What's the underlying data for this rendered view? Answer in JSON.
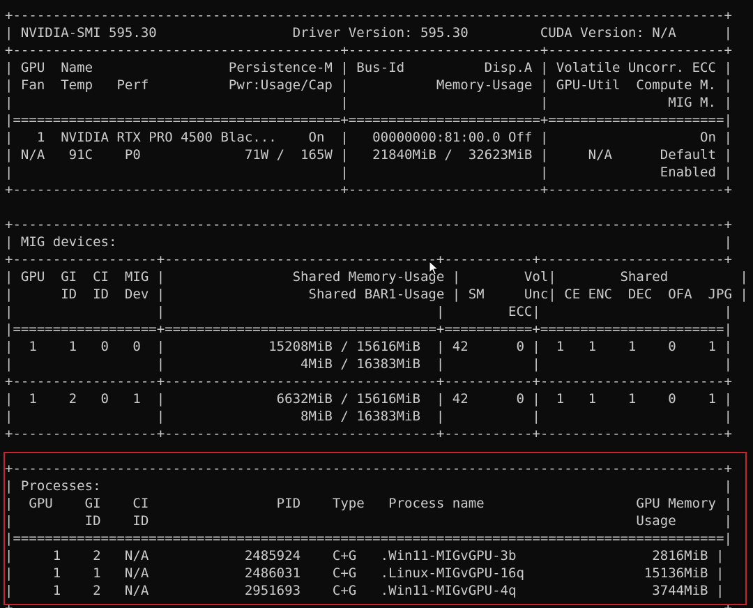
{
  "terminal": {
    "lines": [
      "+-----------------------------------------------------------------------------------------+",
      "| NVIDIA-SMI 595.30                 Driver Version: 595.30         CUDA Version: N/A      |",
      "+-----------------------------------------+------------------------+----------------------+",
      "| GPU  Name                 Persistence-M | Bus-Id          Disp.A | Volatile Uncorr. ECC |",
      "| Fan  Temp   Perf          Pwr:Usage/Cap |           Memory-Usage | GPU-Util  Compute M. |",
      "|                                         |                        |               MIG M. |",
      "|=========================================+========================+======================|",
      "|   1  NVIDIA RTX PRO 4500 Blac...    On  |   00000000:81:00.0 Off |                   On |",
      "| N/A   91C    P0             71W /  165W |   21840MiB /  32623MiB |     N/A      Default |",
      "|                                         |                        |              Enabled |",
      "+-----------------------------------------+------------------------+----------------------+",
      "",
      "+-----------------------------------------------------------------------------------------+",
      "| MIG devices:                                                                            |",
      "+------------------+----------------------------------+-----------+-----------------------+",
      "| GPU  GI  CI  MIG |                Shared Memory-Usage |        Vol|        Shared         |",
      "|      ID  ID  Dev |                  Shared BAR1-Usage | SM     Unc| CE ENC  DEC  OFA  JPG |",
      "|                  |                                  |        ECC|                       |",
      "|==================+==================================+===========+=======================|",
      "|  1    1   0   0  |             15208MiB / 15616MiB  | 42      0 |  1   1    1    0    1 |",
      "|                  |                 4MiB / 16383MiB  |           |                       |",
      "+------------------+----------------------------------+-----------+-----------------------+",
      "|  1    2   0   1  |              6632MiB / 15616MiB  | 42      0 |  1   1    1    0    1 |",
      "|                  |                 8MiB / 16383MiB  |           |                       |",
      "+------------------+----------------------------------+-----------+-----------------------+",
      "",
      "+-----------------------------------------------------------------------------------------+",
      "| Processes:                                                                              |",
      "|  GPU    GI    CI                PID    Type   Process name                   GPU Memory |",
      "|         ID    ID                                                             Usage      |",
      "|=========================================================================================|",
      "|     1    2   N/A            2485924    C+G   .Win11-MIGvGPU-3b                 2816MiB |",
      "|     1    1   N/A            2486031    C+G   .Linux-MIGvGPU-16q               15136MiB |",
      "|     1    2   N/A            2951693    C+G   .Win11-MIGvGPU-4q                 3744MiB |",
      "+-----------------------------------------------------------------------------------------+"
    ]
  },
  "colors": {
    "background": "#0c0c0c",
    "text": "#cccccc",
    "highlight": "#c8262c"
  },
  "icons": {
    "cursor": "mouse-pointer-icon"
  }
}
